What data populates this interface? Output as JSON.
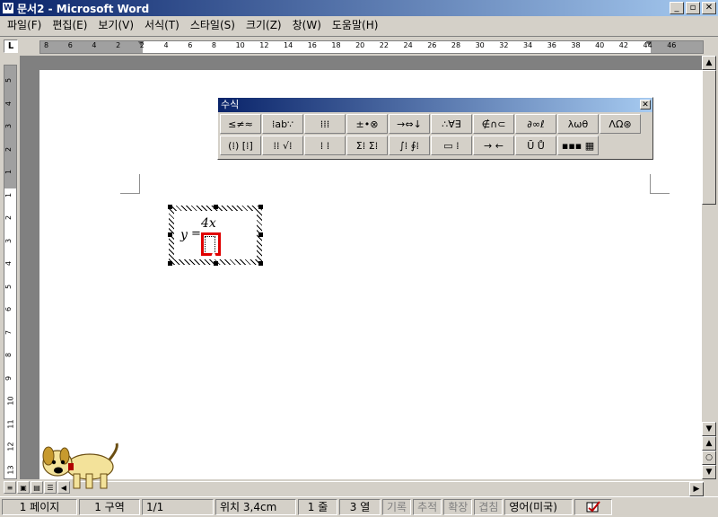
{
  "titlebar": {
    "app_icon": "W",
    "title": "문서2 - Microsoft Word",
    "buttons": [
      "_",
      "▫",
      "✕"
    ]
  },
  "menubar": [
    "파일(F)",
    "편집(E)",
    "보기(V)",
    "서식(T)",
    "스타일(S)",
    "크기(Z)",
    "창(W)",
    "도움말(H)"
  ],
  "ruler": {
    "corner": "L",
    "ticks": [
      "8",
      "6",
      "4",
      "2",
      "2",
      "4",
      "6",
      "8",
      "10",
      "12",
      "14",
      "16",
      "18",
      "20",
      "22",
      "24",
      "26",
      "28",
      "30",
      "32",
      "34",
      "36",
      "38",
      "40",
      "42",
      "44",
      "46"
    ],
    "vticks": [
      "5",
      "4",
      "3",
      "2",
      "1",
      "1",
      "2",
      "3",
      "4",
      "5",
      "6",
      "7",
      "8",
      "9",
      "10",
      "11",
      "12",
      "13"
    ]
  },
  "equation_toolbar": {
    "title": "수식",
    "close": "✕",
    "row1": [
      "≤≠≈",
      "⁞ab∵",
      "⁞⁞⁞",
      "±•⊗",
      "→⇔↓",
      "∴∀∃",
      "∉∩⊂",
      "∂∞ℓ",
      "λωθ",
      "ΛΩ⊛"
    ],
    "row2": [
      "(⁞) [⁞]",
      "⁞⁞ √⁞",
      "⁞ ⁞",
      "Σ⁞ Σ⁞",
      "∫⁞ ∮⁞",
      "▭ ⁞",
      "→ ←",
      "Ū Ů",
      "▪▪▪ ▦"
    ]
  },
  "equation": {
    "lhs": "y",
    "equals": "=",
    "numerator": "4x"
  },
  "statusbar": {
    "page": "1 페이지",
    "section": "1 구역",
    "pages": "1/1",
    "position": "위치 3,4cm",
    "line": "1 줄",
    "column": "3 열",
    "rec": "기록",
    "trk": "추적",
    "ext": "확장",
    "ovr": "겹침",
    "language": "영어(미국)",
    "spell_icon": "spell-check-icon"
  },
  "colors": {
    "title_start": "#0a246a",
    "title_end": "#a6caf0",
    "highlight": "#e00000",
    "face": "#d4d0c8"
  }
}
